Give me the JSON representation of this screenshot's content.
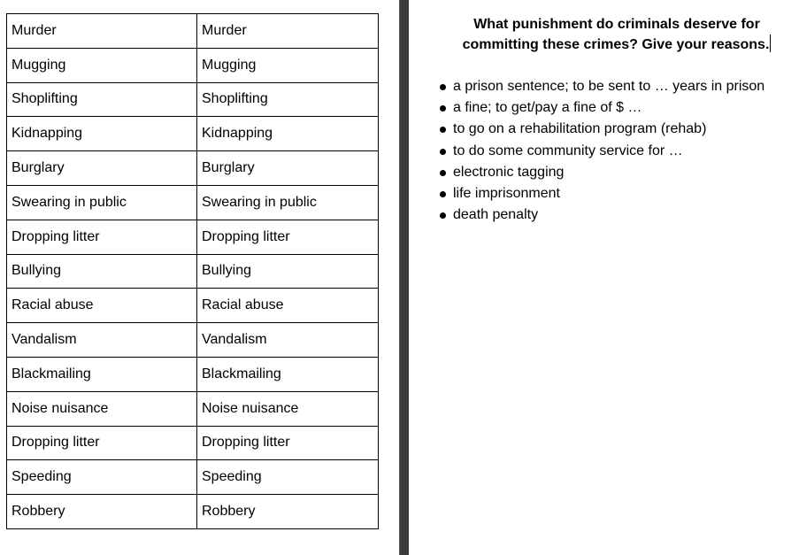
{
  "table": {
    "rows": [
      [
        "Murder",
        "Murder"
      ],
      [
        "Mugging",
        "Mugging"
      ],
      [
        "Shoplifting",
        "Shoplifting"
      ],
      [
        "Kidnapping",
        "Kidnapping"
      ],
      [
        "Burglary",
        "Burglary"
      ],
      [
        "Swearing in public",
        "Swearing in public"
      ],
      [
        "Dropping litter",
        "Dropping litter"
      ],
      [
        "Bullying",
        "Bullying"
      ],
      [
        "Racial abuse",
        "Racial abuse"
      ],
      [
        "Vandalism",
        "Vandalism"
      ],
      [
        "Blackmailing",
        "Blackmailing"
      ],
      [
        "Noise nuisance",
        "Noise nuisance"
      ],
      [
        "Dropping litter",
        "Dropping litter"
      ],
      [
        "Speeding",
        "Speeding"
      ],
      [
        "Robbery",
        "Robbery"
      ]
    ]
  },
  "heading": {
    "line1": "What punishment do criminals deserve for",
    "line2": "committing these crimes? Give your reasons."
  },
  "punishments": [
    "a prison sentence;  to be sent to … years in prison",
    "a fine; to get/pay a fine of $ …",
    "to go on a rehabilitation program (rehab)",
    "to do some community service for …",
    "electronic tagging",
    "life imprisonment",
    "death penalty"
  ]
}
